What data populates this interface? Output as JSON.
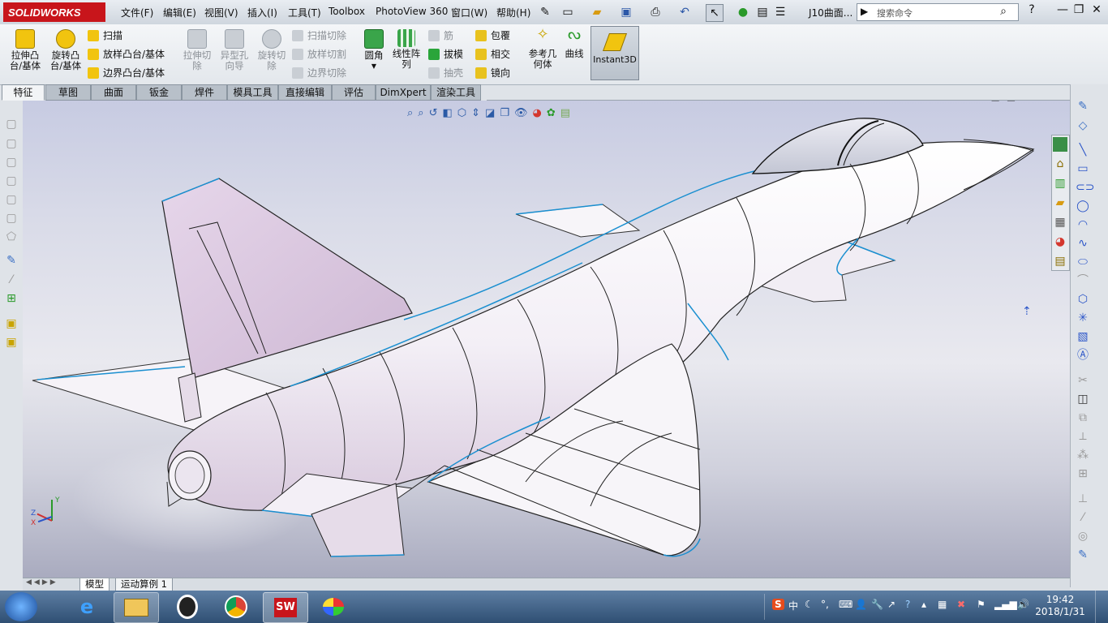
{
  "app": {
    "logo_text": "SOLIDWORKS",
    "document_name": "J10曲面..."
  },
  "menu": [
    "文件(F)",
    "编辑(E)",
    "视图(V)",
    "插入(I)",
    "工具(T)",
    "Toolbox",
    "PhotoView 360",
    "窗口(W)",
    "帮助(H)"
  ],
  "search": {
    "placeholder": "搜索命令"
  },
  "window_controls": {
    "help": "?",
    "minimize": "—",
    "restore": "❐",
    "close": "✕"
  },
  "features": {
    "extrude_boss": "拉伸凸\n台/基体",
    "revolve_boss": "旋转凸\n台/基体",
    "sweep": "扫描",
    "loft": "放样凸台/基体",
    "boundary": "边界凸台/基体",
    "extrude_cut": "拉伸切\n除",
    "hole_wizard": "异型孔\n向导",
    "revolve_cut": "旋转切\n除",
    "swept_cut": "扫描切除",
    "lofted_cut": "放样切割",
    "boundary_cut": "边界切除",
    "fillet": "圆角",
    "linear_pattern": "线性阵\n列",
    "rib": "筋",
    "draft": "拔模",
    "shell": "抽壳",
    "wrap": "包覆",
    "intersect": "相交",
    "mirror": "镜向",
    "ref_geometry": "参考几\n何体",
    "curves": "曲线",
    "instant3d": "Instant3D"
  },
  "tabs": [
    "特征",
    "草图",
    "曲面",
    "钣金",
    "焊件",
    "模具工具",
    "直接编辑",
    "评估",
    "DimXpert",
    "渲染工具"
  ],
  "active_tab": "特征",
  "bottom_tabs": [
    "模型",
    "运动算例 1"
  ],
  "active_bottom_tab": "模型",
  "triad": {
    "x": "X",
    "y": "Y",
    "z": "Z"
  },
  "clock": {
    "time": "19:42",
    "date": "2018/1/31"
  },
  "tray": {
    "ime": "中",
    "input_mode": "S"
  },
  "colors": {
    "accent": "#c8151b",
    "edge_blue": "#1a8fd0",
    "body": "#f2eef5",
    "body_shadow": "#d9c8dc"
  }
}
